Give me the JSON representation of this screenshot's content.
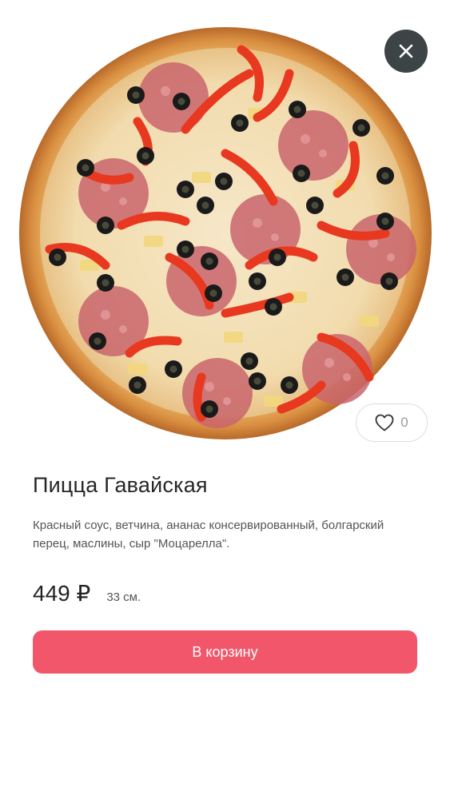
{
  "product": {
    "title": "Пицца Гавайская",
    "description": "Красный соус, ветчина, ананас консервированный, болгарский перец, маслины, сыр \"Моцарелла\".",
    "price": "449 ₽",
    "size": "33 см.",
    "likes": "0",
    "image_icon": "pizza-photo"
  },
  "actions": {
    "add_to_cart_label": "В корзину",
    "close_icon": "close-icon",
    "like_icon": "heart-icon"
  },
  "colors": {
    "accent": "#f2566a",
    "close_bg": "#3d4446",
    "text_primary": "#262626",
    "text_secondary": "#555555"
  }
}
